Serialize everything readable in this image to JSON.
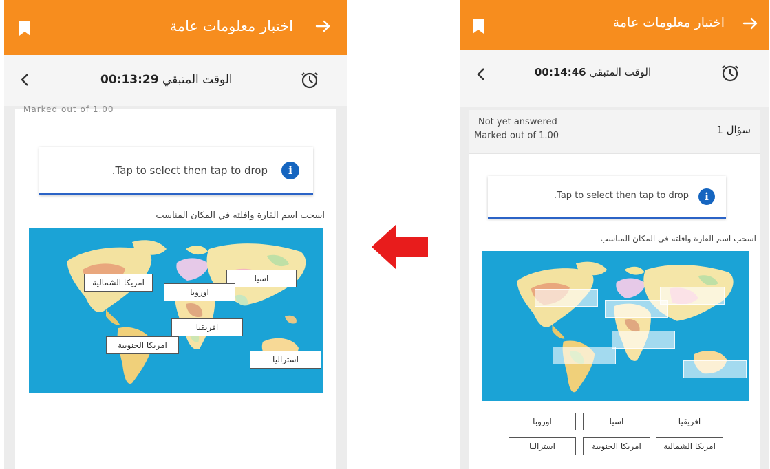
{
  "app_title": "اختبار معلومات عامة",
  "timer_label": "الوقت المتبقي",
  "left": {
    "timer_value": "00:13:29",
    "cut_text": "Marked out of 1.00",
    "info_text": ".Tap to select then tap to drop",
    "instruction": "اسحب اسم القارة وافلته في المكان المناسب",
    "placed_labels": {
      "north_america": "امريكا الشمالية",
      "asia": "اسيا",
      "europe": "اوروبا",
      "africa": "افريقيا",
      "south_america": "امريكا الجنوبية",
      "australia": "استراليا"
    }
  },
  "right": {
    "timer_value": "00:14:46",
    "status_line1": "Not yet answered",
    "status_line2": "Marked out of 1.00",
    "question_label": "سؤال 1",
    "info_text": ".Tap to select then tap to drop",
    "instruction": "اسحب اسم القارة وافلته في المكان المناسب",
    "choices": {
      "africa": "افريقيا",
      "asia": "اسيا",
      "europe": "اوروبا",
      "north_america": "امريكا الشمالية",
      "south_america": "امريكا الجنوبية",
      "australia": "استراليا"
    }
  },
  "colors": {
    "appbar": "#f78d1e",
    "ocean": "#1ba3d6",
    "info_accent": "#2b63c6",
    "info_icon": "#1565c0",
    "arrow": "#e81c1c"
  },
  "icons": {
    "bookmark": "bookmark-icon",
    "back": "arrow-right-icon",
    "chevron": "chevron-left-icon",
    "timer": "stopwatch-icon",
    "info": "info-icon",
    "transition": "red-arrow-left-icon"
  }
}
